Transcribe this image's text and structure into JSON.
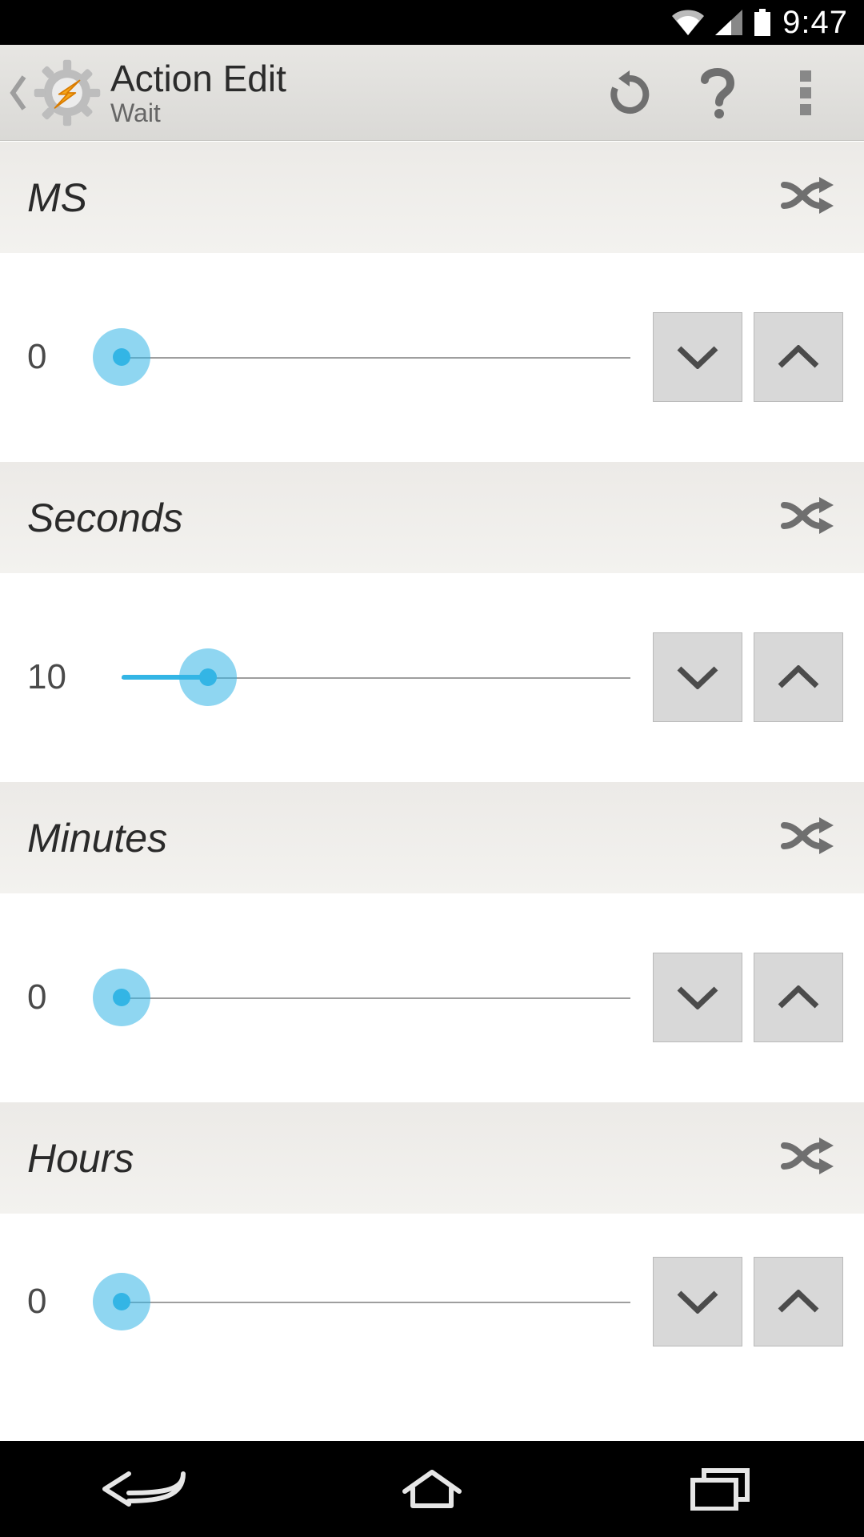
{
  "statusbar": {
    "time": "9:47"
  },
  "appbar": {
    "title": "Action Edit",
    "subtitle": "Wait"
  },
  "sections": [
    {
      "label": "MS",
      "value": "0",
      "percent": 0
    },
    {
      "label": "Seconds",
      "value": "10",
      "percent": 17
    },
    {
      "label": "Minutes",
      "value": "0",
      "percent": 0
    },
    {
      "label": "Hours",
      "value": "0",
      "percent": 0
    }
  ]
}
